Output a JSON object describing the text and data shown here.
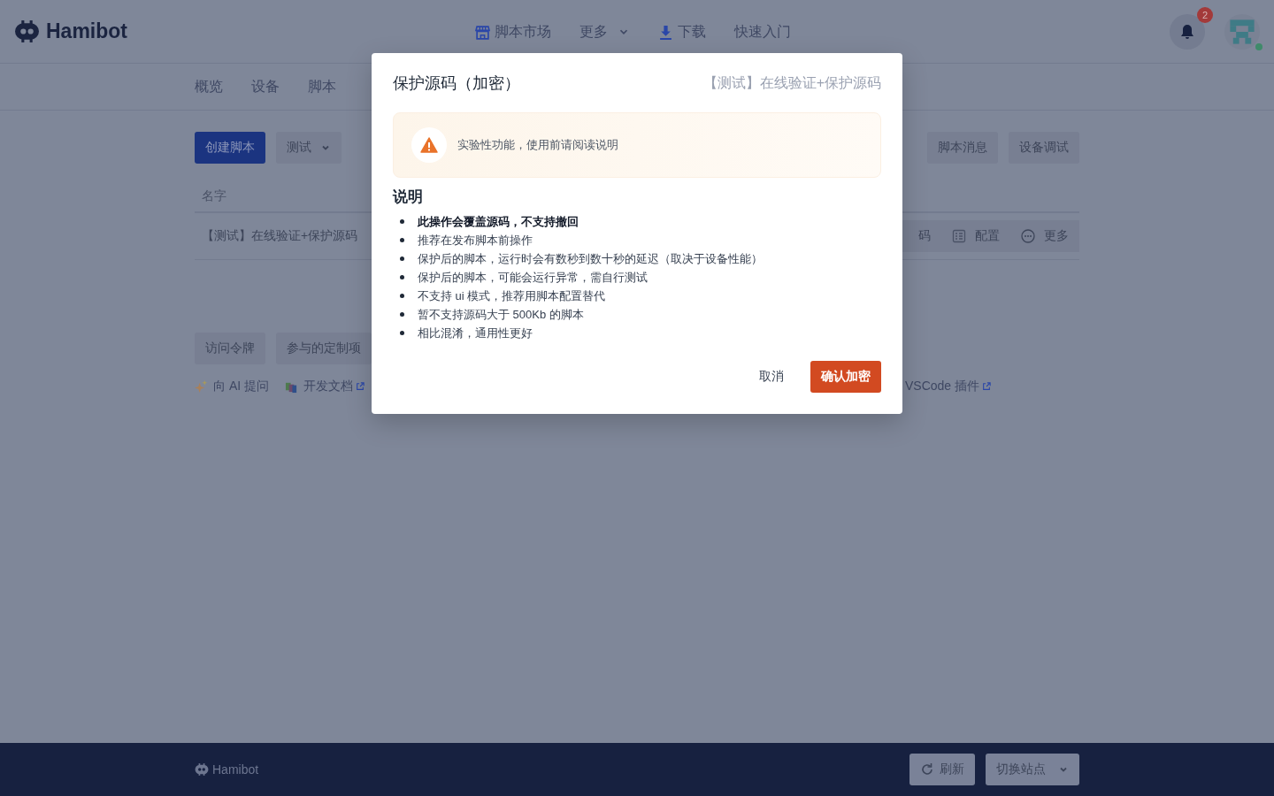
{
  "header": {
    "brand": "Hamibot",
    "nav": [
      {
        "label": "脚本市场",
        "kind": "store"
      },
      {
        "label": "更多",
        "kind": "dropdown"
      },
      {
        "label": "下载",
        "kind": "download"
      },
      {
        "label": "快速入门",
        "kind": "plain"
      }
    ],
    "notifications": {
      "count": "2"
    },
    "avatar": {
      "online": true
    }
  },
  "tabs": [
    {
      "label": "概览"
    },
    {
      "label": "设备"
    },
    {
      "label": "脚本"
    }
  ],
  "toolbar": {
    "left": [
      {
        "label": "创建脚本",
        "kind": "primary"
      },
      {
        "label": "测试",
        "kind": "dropdown"
      }
    ],
    "right": [
      "脚本消息",
      "设备调试"
    ]
  },
  "table": {
    "columns": [
      "名字"
    ],
    "rows": [
      {
        "name": "【测试】在线验证+保护源码",
        "actions": [
          {
            "label": "码",
            "kind": "plain"
          },
          {
            "label": "配置",
            "kind": "config"
          },
          {
            "label": "更多",
            "kind": "more"
          }
        ]
      }
    ]
  },
  "shortcuts": [
    "访问令牌",
    "参与的定制项"
  ],
  "resources": [
    {
      "label": "向 AI 提问",
      "kind": "ai",
      "external": false
    },
    {
      "label": "开发文档",
      "kind": "docs",
      "external": true
    },
    {
      "label": "VSCode 插件",
      "kind": "plain",
      "external": true
    }
  ],
  "footer": {
    "brand": "Hamibot",
    "buttons": [
      {
        "label": "刷新",
        "kind": "refresh"
      },
      {
        "label": "切换站点",
        "kind": "dropdown"
      }
    ]
  },
  "dialog": {
    "title": "保护源码（加密）",
    "subtitle": "【测试】在线验证+保护源码",
    "warning": "实验性功能，使用前请阅读说明",
    "heading": "说明",
    "items": [
      {
        "text": "此操作会覆盖源码，不支持撤回",
        "bold": true
      },
      {
        "text": "推荐在发布脚本前操作",
        "bold": false
      },
      {
        "text": "保护后的脚本，运行时会有数秒到数十秒的延迟（取决于设备性能）",
        "bold": false
      },
      {
        "text": "保护后的脚本，可能会运行异常，需自行测试",
        "bold": false
      },
      {
        "text": "不支持 ui 模式，推荐用脚本配置替代",
        "bold": false
      },
      {
        "text": "暂不支持源码大于 500Kb 的脚本",
        "bold": false
      },
      {
        "text": "相比混淆，通用性更好",
        "bold": false
      }
    ],
    "cancel": "取消",
    "confirm": "确认加密"
  }
}
